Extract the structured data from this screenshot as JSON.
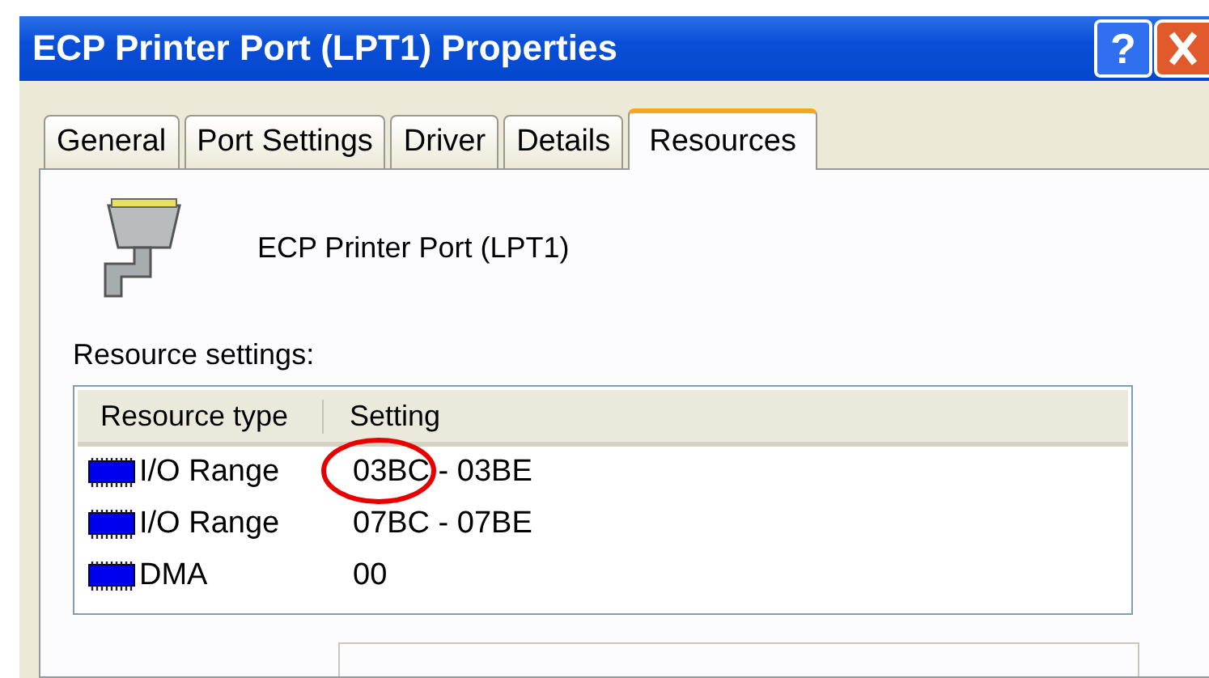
{
  "window": {
    "title": "ECP Printer Port (LPT1) Properties",
    "help_button": "?"
  },
  "tabs": [
    {
      "label": "General",
      "selected": false
    },
    {
      "label": "Port Settings",
      "selected": false
    },
    {
      "label": "Driver",
      "selected": false
    },
    {
      "label": "Details",
      "selected": false
    },
    {
      "label": "Resources",
      "selected": true
    }
  ],
  "device": {
    "name": "ECP Printer Port (LPT1)"
  },
  "resource_settings": {
    "label": "Resource settings:",
    "columns": [
      "Resource type",
      "Setting"
    ],
    "rows": [
      {
        "type": "I/O Range",
        "setting": "03BC - 03BE",
        "circled": true
      },
      {
        "type": "I/O Range",
        "setting": "07BC - 07BE",
        "circled": false
      },
      {
        "type": "DMA",
        "setting": "00",
        "circled": false
      }
    ]
  }
}
